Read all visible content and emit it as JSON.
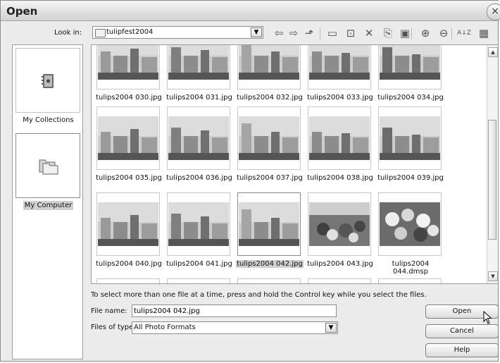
{
  "window": {
    "title": "Open",
    "close_symbol": "×"
  },
  "lookin": {
    "label": "Look in:",
    "value": "tulipfest2004",
    "dropdown_symbol": "▼"
  },
  "toolbar": [
    {
      "name": "back-icon",
      "symbol": "⇦"
    },
    {
      "name": "forward-icon",
      "symbol": "⇨"
    },
    {
      "name": "up-folder-icon",
      "symbol": "⬏"
    },
    {
      "name": "new-folder-icon",
      "symbol": "▭"
    },
    {
      "name": "select-all-icon",
      "symbol": "⊡"
    },
    {
      "name": "delete-icon",
      "symbol": "✕"
    },
    {
      "name": "copy-icon",
      "symbol": "⎘"
    },
    {
      "name": "slideshow-icon",
      "symbol": "▣"
    },
    {
      "name": "zoom-in-icon",
      "symbol": "⊕"
    },
    {
      "name": "zoom-out-icon",
      "symbol": "⊖"
    },
    {
      "name": "sort-icon",
      "symbol": "A↓Z"
    },
    {
      "name": "view-icon",
      "symbol": "▦"
    }
  ],
  "sidebar": {
    "items": [
      {
        "label": "My Collections",
        "icon": "collections-icon",
        "selected": false
      },
      {
        "label": "My Computer",
        "icon": "computer-folders-icon",
        "selected": true
      }
    ]
  },
  "files": {
    "rows": [
      [
        "tulips2004 030.jpg",
        "tulips2004 031.jpg",
        "tulips2004 032.jpg",
        "tulips2004 033.jpg",
        "tulips2004 034.jpg"
      ],
      [
        "tulips2004 035.jpg",
        "tulips2004 036.jpg",
        "tulips2004 037.jpg",
        "tulips2004 038.jpg",
        "tulips2004 039.jpg"
      ],
      [
        "tulips2004 040.jpg",
        "tulips2004 041.jpg",
        "tulips2004 042.jpg",
        "tulips2004 043.jpg",
        "tulips2004 044.dmsp"
      ]
    ],
    "selected": "tulips2004 042.jpg"
  },
  "form": {
    "hint": "To select more than one file at a time, press and hold the Control key while you select the files.",
    "file_name_label": "File name:",
    "file_name_value": "tulips2004 042.jpg",
    "file_type_label": "Files of type:",
    "file_type_value": "All Photo Formats",
    "dropdown_symbol": "▼"
  },
  "buttons": {
    "open": "Open",
    "cancel": "Cancel",
    "help": "Help"
  },
  "scrollbar": {
    "up_symbol": "▲",
    "down_symbol": "▼"
  }
}
